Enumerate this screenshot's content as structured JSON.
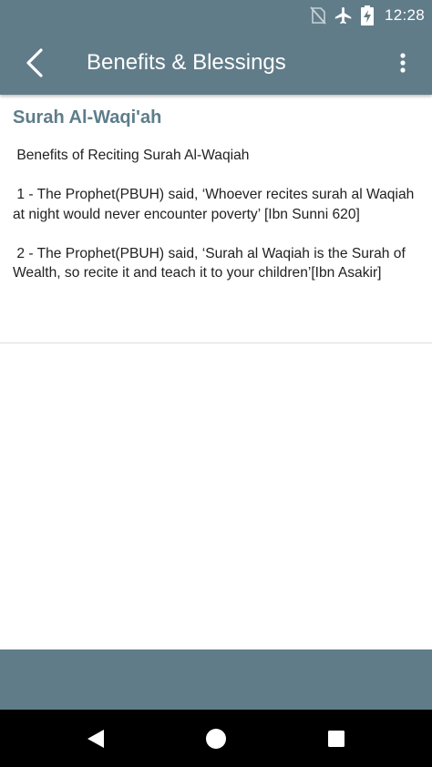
{
  "status_bar": {
    "time": "12:28",
    "icons": [
      "no-sim-icon",
      "airplane-mode-icon",
      "battery-charging-icon"
    ]
  },
  "app_bar": {
    "title": "Benefits & Blessings",
    "back_icon": "chevron-left-icon",
    "overflow_icon": "more-vert-icon"
  },
  "content": {
    "surah_title": "Surah Al-Waqi'ah",
    "benefits_text": " Benefits of Reciting Surah Al-Waqiah\n\n 1 - The Prophet(PBUH) said, ‘Whoever recites surah al Waqiah at night would never encounter poverty’ [Ibn Sunni 620]\n\n 2 - The Prophet(PBUH) said, ‘Surah al Waqiah is the Surah of Wealth, so recite it and teach it to your children’[Ibn Asakir]"
  },
  "colors": {
    "primary": "#617c89",
    "title_accent": "#5e7d8a",
    "nav_bar": "#000000"
  },
  "nav_bar": {
    "buttons": [
      "back-triangle-icon",
      "home-circle-icon",
      "recents-square-icon"
    ]
  }
}
